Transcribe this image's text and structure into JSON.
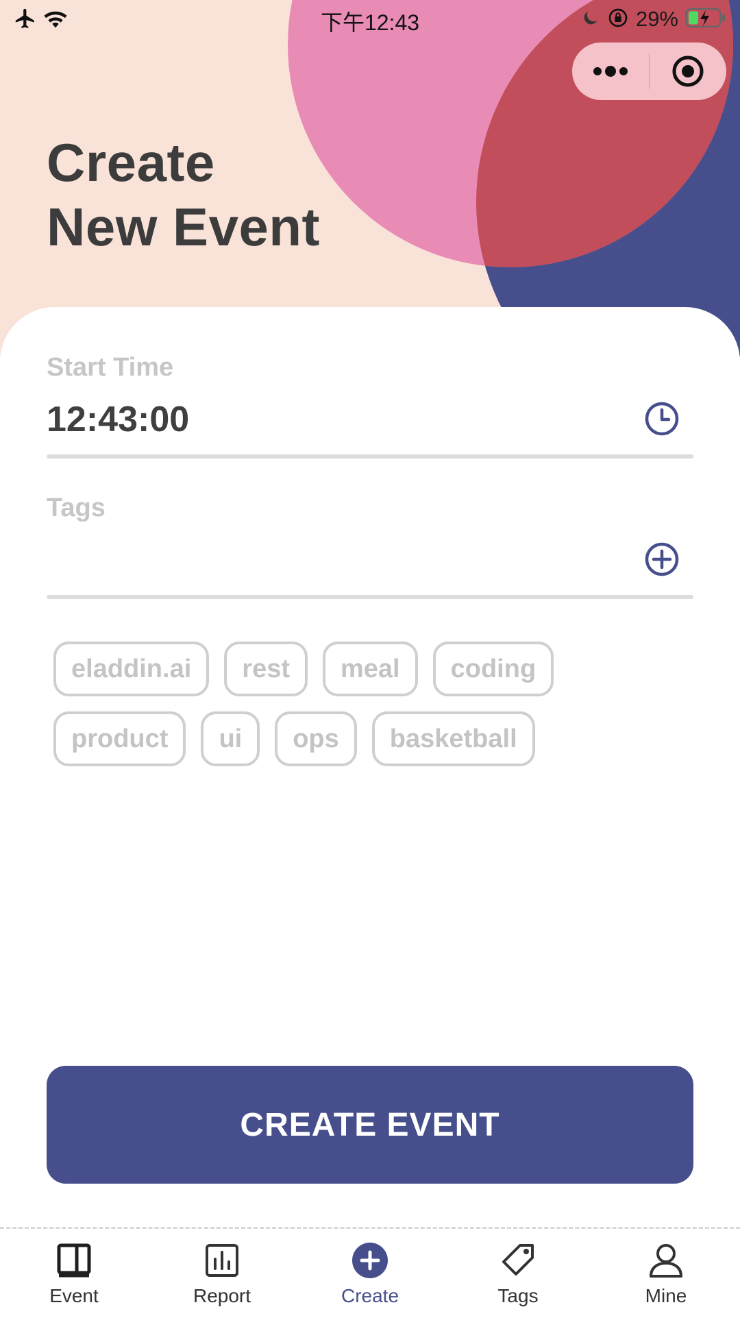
{
  "status_bar": {
    "time": "下午12:43",
    "battery": "29%"
  },
  "page": {
    "title_line1": "Create",
    "title_line2": "New Event"
  },
  "form": {
    "start_time": {
      "label": "Start Time",
      "value": "12:43:00",
      "icon": "clock-icon"
    },
    "tags": {
      "label": "Tags",
      "value": "",
      "icon": "plus-circle-icon"
    }
  },
  "tag_chips": [
    [
      "eladdin.ai",
      "rest",
      "meal",
      "coding"
    ],
    [
      "product",
      "ui",
      "ops",
      "basketball"
    ]
  ],
  "create_button": {
    "label": "CREATE EVENT"
  },
  "tabbar": {
    "items": [
      {
        "label": "Event",
        "icon": "book-icon"
      },
      {
        "label": "Report",
        "icon": "bar-chart-icon"
      },
      {
        "label": "Create",
        "icon": "plus-circle-icon"
      },
      {
        "label": "Tags",
        "icon": "tag-icon"
      },
      {
        "label": "Mine",
        "icon": "user-icon"
      }
    ],
    "active_index": 2
  },
  "colors": {
    "accent": "#464f8c",
    "header_bg": "#f9e3d8",
    "pink": "#e88bb5",
    "red": "#c24d5b",
    "navy": "#464f8c",
    "muted": "#c6c6c6"
  }
}
